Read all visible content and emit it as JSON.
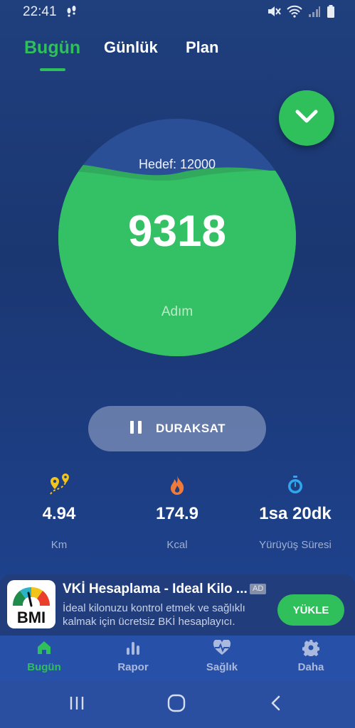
{
  "status_bar": {
    "time": "22:41"
  },
  "tabs": [
    {
      "label": "Bugün",
      "active": true
    },
    {
      "label": "Günlük",
      "active": false
    },
    {
      "label": "Plan",
      "active": false
    }
  ],
  "steps": {
    "goal_label": "Hedef: 12000",
    "value": "9318",
    "unit": "Adım",
    "goal": 12000,
    "current": 9318
  },
  "pause_button": {
    "label": "DURAKSAT"
  },
  "stats": [
    {
      "icon": "route-pin-icon",
      "value": "4.94",
      "label": "Km"
    },
    {
      "icon": "flame-icon",
      "value": "174.9",
      "label": "Kcal"
    },
    {
      "icon": "stopwatch-icon",
      "value": "1sa 20dk",
      "label": "Yürüyüş Süresi"
    }
  ],
  "ad": {
    "logo_text": "BMI",
    "title": "VKİ Hesaplama - Ideal Kilo ...",
    "badge": "AD",
    "description": "İdeal kilonuzu kontrol etmek ve sağlıklı kalmak için ücretsiz BKİ hesaplayıcı.",
    "cta": "YÜKLE"
  },
  "bottom_nav": [
    {
      "icon": "home-icon",
      "label": "Bugün",
      "active": true
    },
    {
      "icon": "bar-chart-icon",
      "label": "Rapor",
      "active": false
    },
    {
      "icon": "heartbeat-icon",
      "label": "Sağlık",
      "active": false
    },
    {
      "icon": "gear-icon",
      "label": "Daha",
      "active": false
    }
  ],
  "colors": {
    "accent": "#2fbf5b",
    "background": "#1f3f7d",
    "nav": "#2751a8"
  }
}
